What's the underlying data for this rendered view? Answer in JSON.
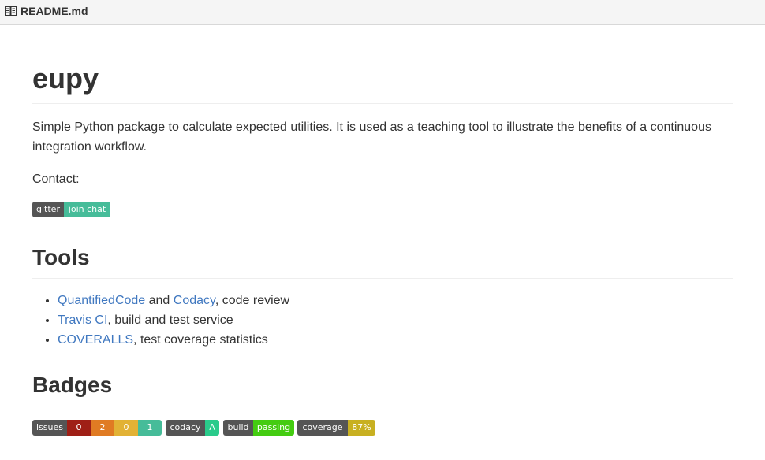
{
  "file_header": {
    "icon": "book-icon",
    "filename": "README.md"
  },
  "readme": {
    "title": "eupy",
    "description": "Simple Python package to calculate expected utilities. It is used as a teaching tool to illustrate the benefits of a continuous integration workflow.",
    "contact_label": "Contact:",
    "gitter_badge": {
      "label": "gitter",
      "value": "join chat",
      "colors": {
        "label": "#555555",
        "value": "#46bc99"
      }
    },
    "tools_heading": "Tools",
    "tools": [
      {
        "links": [
          "QuantifiedCode",
          "Codacy"
        ],
        "joiner": " and ",
        "suffix": ", code review"
      },
      {
        "links": [
          "Travis CI"
        ],
        "suffix": ", build and test service"
      },
      {
        "links": [
          "COVERALLS"
        ],
        "suffix": ", test coverage statistics"
      }
    ],
    "badges_heading": "Badges",
    "badges": {
      "issues": {
        "label": "issues",
        "counts": [
          "0",
          "2",
          "0",
          "1"
        ],
        "colors": [
          "#9f1f16",
          "#e07b23",
          "#e2b235",
          "#46bc99"
        ]
      },
      "codacy": {
        "label": "codacy",
        "value": "A",
        "color": "#2acb8b"
      },
      "build": {
        "label": "build",
        "value": "passing",
        "color": "#44cc11"
      },
      "coverage": {
        "label": "coverage",
        "value": "87%",
        "color": "#c8b021"
      }
    }
  },
  "colors": {
    "link": "#4078c0",
    "text": "#333333",
    "header_bg": "#f5f5f5"
  }
}
